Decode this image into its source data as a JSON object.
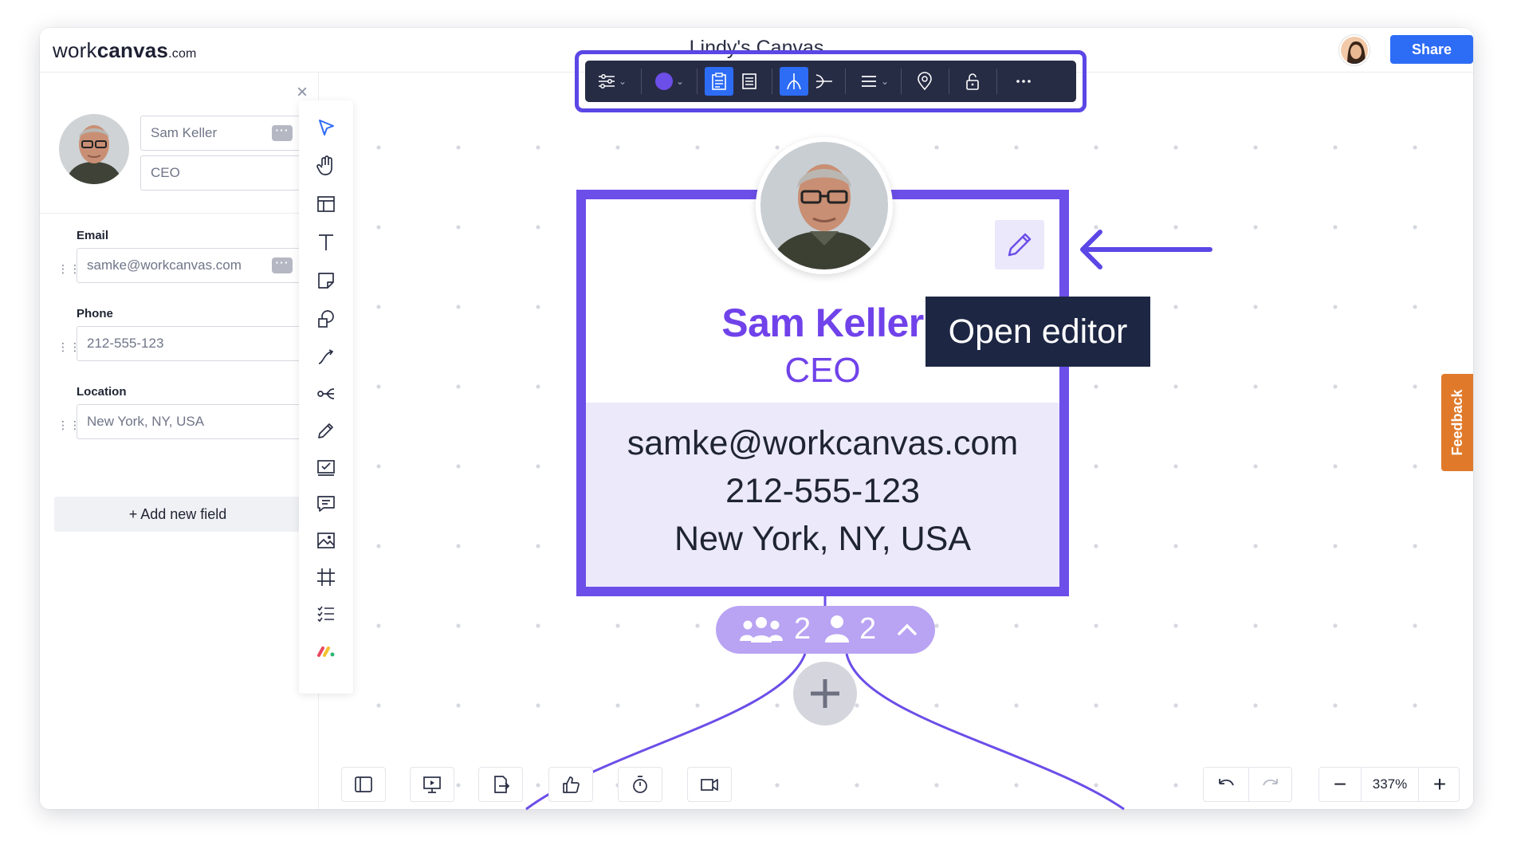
{
  "app": {
    "logo_prefix": "work",
    "logo_bold": "canvas",
    "logo_suffix": ".com",
    "title": "Lindy's Canvas",
    "share_label": "Share"
  },
  "sidebar": {
    "name_value": "Sam Keller",
    "role_value": "CEO",
    "fields": [
      {
        "label": "Email",
        "value": "samke@workcanvas.com"
      },
      {
        "label": "Phone",
        "value": "212-555-123"
      },
      {
        "label": "Location",
        "value": "New York, NY, USA"
      }
    ],
    "add_field_label": "+ Add new field"
  },
  "card": {
    "name": "Sam Keller",
    "role": "CEO",
    "email": "samke@workcanvas.com",
    "phone": "212-555-123",
    "location": "New York, NY, USA",
    "team_count": "2",
    "person_count": "2"
  },
  "tooltip": "Open editor",
  "feedback_label": "Feedback",
  "zoom": {
    "value": "337%",
    "minus": "−",
    "plus": "+"
  },
  "colors": {
    "accent": "#6c4ee8",
    "toolbar_bg": "#272c45",
    "share_blue": "#2d6cf5",
    "feedback_orange": "#e07a2a",
    "tooltip_bg": "#1d2744"
  },
  "icons": {
    "toolbox": [
      "select-arrow-icon",
      "hand-icon",
      "template-icon",
      "text-icon",
      "sticky-note-icon",
      "shapes-icon",
      "connector-icon",
      "mindmap-icon",
      "pen-icon",
      "checkbox-card-icon",
      "comment-icon",
      "image-icon",
      "frame-icon",
      "checklist-icon",
      "apps-icon"
    ],
    "object_toolbar": [
      "settings-sliders-icon",
      "color-fill-icon",
      "card-view-icon",
      "doc-view-icon",
      "tree-down-icon",
      "tree-left-icon",
      "align-icon",
      "location-pin-icon",
      "unlock-icon",
      "more-icon"
    ],
    "bottom": [
      "sidebar-toggle-icon",
      "present-icon",
      "export-icon",
      "vote-icon",
      "timer-icon",
      "video-icon",
      "undo-icon",
      "redo-icon"
    ]
  }
}
